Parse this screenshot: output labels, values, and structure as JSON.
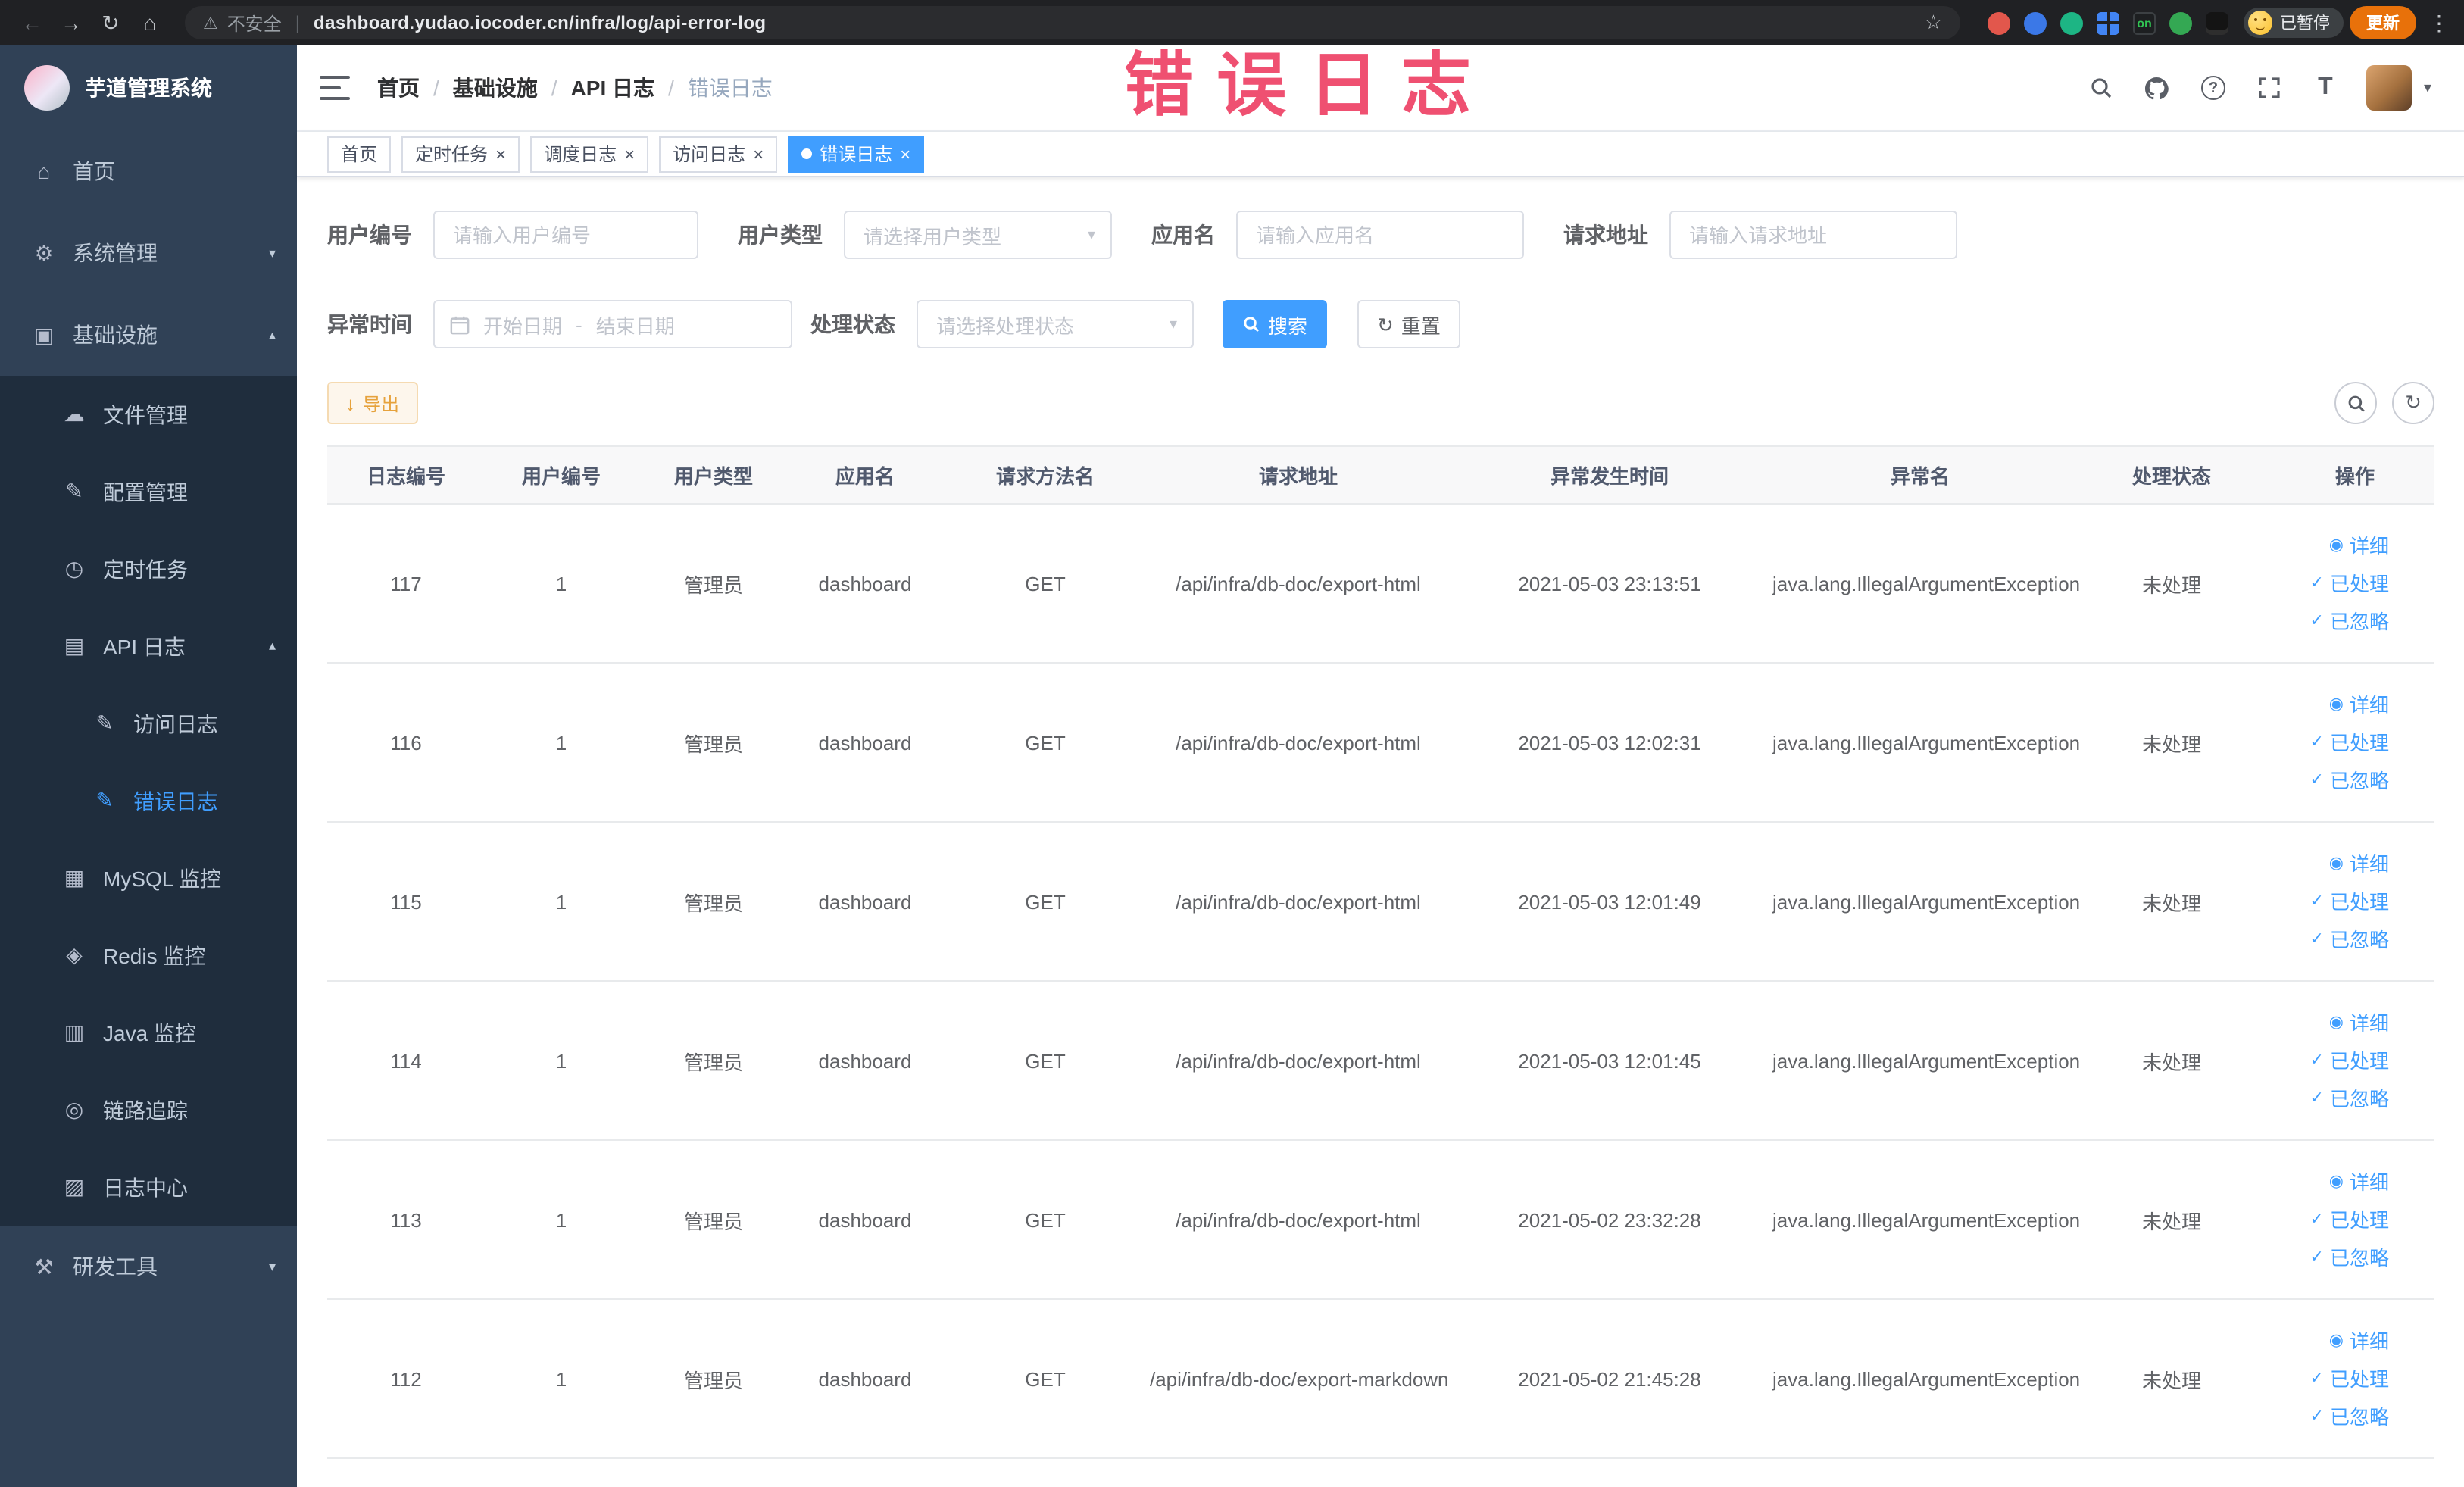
{
  "browser": {
    "security_label": "不安全",
    "url": "dashboard.yudao.iocoder.cn/infra/log/api-error-log",
    "paused_badge": "已暂停",
    "update_label": "更新",
    "extension_on_label": "on"
  },
  "watermark_label": "错误日志",
  "sidebar": {
    "title": "芋道管理系统",
    "items": {
      "home": "首页",
      "system": "系统管理",
      "infra": "基础设施",
      "file": "文件管理",
      "config": "配置管理",
      "job": "定时任务",
      "api_log": "API 日志",
      "access_log": "访问日志",
      "error_log": "错误日志",
      "mysql": "MySQL 监控",
      "redis": "Redis 监控",
      "java": "Java 监控",
      "trace": "链路追踪",
      "log_center": "日志中心",
      "dev_tools": "研发工具"
    }
  },
  "header": {
    "breadcrumb": [
      "首页",
      "基础设施",
      "API 日志",
      "错误日志"
    ],
    "separator": "/"
  },
  "tabs": [
    {
      "label": "首页"
    },
    {
      "label": "定时任务"
    },
    {
      "label": "调度日志"
    },
    {
      "label": "访问日志"
    },
    {
      "label": "错误日志"
    }
  ],
  "filters": {
    "user_id": {
      "label": "用户编号",
      "placeholder": "请输入用户编号"
    },
    "user_type": {
      "label": "用户类型",
      "placeholder": "请选择用户类型"
    },
    "app_name": {
      "label": "应用名",
      "placeholder": "请输入应用名"
    },
    "request_url": {
      "label": "请求地址",
      "placeholder": "请输入请求地址"
    },
    "exception_time": {
      "label": "异常时间",
      "start_placeholder": "开始日期",
      "separator": "-",
      "end_placeholder": "结束日期"
    },
    "process_status": {
      "label": "处理状态",
      "placeholder": "请选择处理状态"
    },
    "search_label": "搜索",
    "reset_label": "重置"
  },
  "toolbar": {
    "export_label": "导出"
  },
  "table": {
    "columns": [
      "日志编号",
      "用户编号",
      "用户类型",
      "应用名",
      "请求方法名",
      "请求地址",
      "异常发生时间",
      "异常名",
      "处理状态",
      "操作"
    ],
    "actions": {
      "detail": "详细",
      "processed": "已处理",
      "ignored": "已忽略"
    },
    "rows": [
      {
        "id": "117",
        "user_id": "1",
        "user_type": "管理员",
        "app_name": "dashboard",
        "method": "GET",
        "url": "/api/infra/db-doc/export-html",
        "time": "2021-05-03 23:13:51",
        "exception": "java.lang.IllegalArgumentException",
        "status": "未处理"
      },
      {
        "id": "116",
        "user_id": "1",
        "user_type": "管理员",
        "app_name": "dashboard",
        "method": "GET",
        "url": "/api/infra/db-doc/export-html",
        "time": "2021-05-03 12:02:31",
        "exception": "java.lang.IllegalArgumentException",
        "status": "未处理"
      },
      {
        "id": "115",
        "user_id": "1",
        "user_type": "管理员",
        "app_name": "dashboard",
        "method": "GET",
        "url": "/api/infra/db-doc/export-html",
        "time": "2021-05-03 12:01:49",
        "exception": "java.lang.IllegalArgumentException",
        "status": "未处理"
      },
      {
        "id": "114",
        "user_id": "1",
        "user_type": "管理员",
        "app_name": "dashboard",
        "method": "GET",
        "url": "/api/infra/db-doc/export-html",
        "time": "2021-05-03 12:01:45",
        "exception": "java.lang.IllegalArgumentException",
        "status": "未处理"
      },
      {
        "id": "113",
        "user_id": "1",
        "user_type": "管理员",
        "app_name": "dashboard",
        "method": "GET",
        "url": "/api/infra/db-doc/export-html",
        "time": "2021-05-02 23:32:28",
        "exception": "java.lang.IllegalArgumentException",
        "status": "未处理"
      },
      {
        "id": "112",
        "user_id": "1",
        "user_type": "管理员",
        "app_name": "dashboard",
        "method": "GET",
        "url": "/api/infra/db-doc/export-markdown",
        "time": "2021-05-02 21:45:28",
        "exception": "java.lang.IllegalArgumentException",
        "status": "未处理"
      }
    ]
  },
  "icons": {
    "back": "←",
    "forward": "→",
    "reload": "↻",
    "home": "⌂",
    "warning": "⚠",
    "star": "☆",
    "menu_dots": "⋮",
    "caret_down": "▾",
    "caret_up": "▴",
    "menu_home": "⌂",
    "menu_system": "⚙",
    "menu_infra": "▣",
    "menu_file": "☁",
    "menu_config": "✎",
    "menu_job": "◷",
    "menu_api_log": "▤",
    "menu_access_log": "✎",
    "menu_error_log": "✎",
    "menu_mysql": "▦",
    "menu_redis": "◈",
    "menu_java": "▥",
    "menu_trace": "◎",
    "menu_log_center": "▨",
    "menu_dev_tools": "⚒",
    "close": "×",
    "view": "◉",
    "check": "✓",
    "download": "↓",
    "refresh": "↻",
    "help": "?",
    "text_size": "T"
  }
}
